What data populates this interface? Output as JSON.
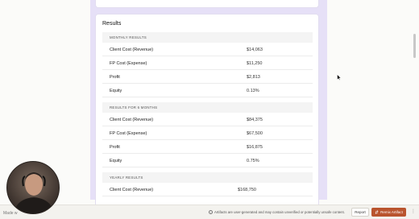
{
  "card": {
    "title": "Results",
    "sections": [
      {
        "header": "MONTHLY RESULTS",
        "rows": [
          {
            "label": "Client Cost (Revenue)",
            "value": "$14,063"
          },
          {
            "label": "FP Cost (Expense)",
            "value": "$11,250"
          },
          {
            "label": "Profit",
            "value": "$2,813"
          },
          {
            "label": "Equity",
            "value": "0.13%"
          }
        ]
      },
      {
        "header": "RESULTS FOR 6 MONTHS",
        "rows": [
          {
            "label": "Client Cost (Revenue)",
            "value": "$84,375"
          },
          {
            "label": "FP Cost (Expense)",
            "value": "$67,500"
          },
          {
            "label": "Profit",
            "value": "$16,875"
          },
          {
            "label": "Equity",
            "value": "0.75%"
          }
        ]
      },
      {
        "header": "YEARLY RESULTS",
        "rows": [
          {
            "label": "Client Cost (Revenue)",
            "value": "$168,750"
          }
        ]
      }
    ]
  },
  "footer": {
    "made_with": "Made w",
    "disclaimer": "Artifacts are user-generated and may contain unverified or potentially unsafe content.",
    "report_label": "Report",
    "remix_label": "Remix Artifact",
    "more_glyph": "⋮",
    "info_glyph": "i"
  },
  "colors": {
    "accent": "#b9542e",
    "panel": "#e6e0f7"
  }
}
